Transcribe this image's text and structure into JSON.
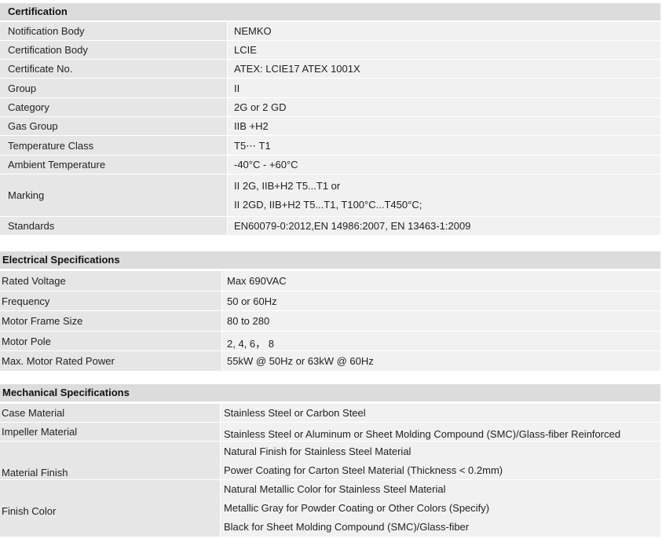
{
  "certification": {
    "title": "Certification",
    "rows": [
      {
        "label": "Notification Body",
        "values": [
          "NEMKO"
        ]
      },
      {
        "label": "Certification Body",
        "values": [
          "LCIE"
        ]
      },
      {
        "label": "Certificate No.",
        "values": [
          "ATEX: LCIE17 ATEX 1001X"
        ]
      },
      {
        "label": "Group",
        "values": [
          "II"
        ]
      },
      {
        "label": "Category",
        "values": [
          "2G or 2 GD"
        ]
      },
      {
        "label": "Gas Group",
        "values": [
          "IIB +H2"
        ]
      },
      {
        "label": "Temperature Class",
        "values": [
          "T5⋯ T1"
        ]
      },
      {
        "label": "Ambient Temperature",
        "values": [
          "-40°C - +60°C"
        ]
      },
      {
        "label": "Marking",
        "values": [
          "II 2G, IIB+H2 T5...T1 or",
          "II 2GD, IIB+H2 T5...T1, T100°C...T450°C;"
        ]
      },
      {
        "label": "Standards",
        "values": [
          "EN60079-0:2012,EN 14986:2007, EN 13463-1:2009"
        ]
      }
    ]
  },
  "electrical": {
    "title": "Electrical Specifications",
    "rows": [
      {
        "label": "Rated Voltage",
        "values": [
          "Max 690VAC"
        ]
      },
      {
        "label": "Frequency",
        "values": [
          "50 or 60Hz"
        ]
      },
      {
        "label": "Motor Frame Size",
        "values": [
          "80 to 280"
        ]
      },
      {
        "label": "Motor Pole",
        "values": [
          "2, 4, 6， 8"
        ]
      },
      {
        "label": "Max. Motor Rated Power",
        "values": [
          "55kW @ 50Hz or 63kW @ 60Hz"
        ]
      }
    ]
  },
  "mechanical": {
    "title": "Mechanical Specifications",
    "rows": [
      {
        "label": "Case Material",
        "values": [
          "Stainless Steel or Carbon Steel"
        ]
      },
      {
        "label": "Impeller Material",
        "values": [
          "Stainless Steel or Aluminum or Sheet Molding Compound (SMC)/Glass-fiber Reinforced"
        ]
      },
      {
        "label": "Material Finish",
        "values": [
          "Natural Finish for Stainless Steel Material",
          "Power Coating for Carton Steel Material (Thickness < 0.2mm)"
        ]
      },
      {
        "label": "Finish Color",
        "values": [
          "Natural Metallic Color for Stainless Steel Material",
          "Metallic Gray for Powder Coating or Other Colors (Specify)",
          "Black for Sheet Molding Compound (SMC)/Glass-fiber"
        ]
      }
    ]
  }
}
